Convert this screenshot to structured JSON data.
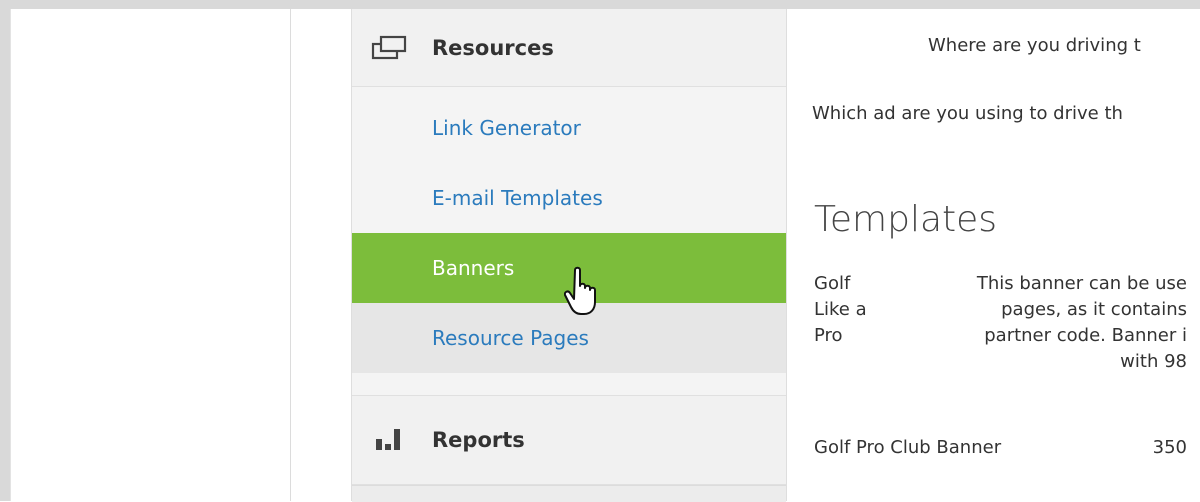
{
  "sidebar": {
    "resources": {
      "title": "Resources",
      "icon": "windows-icon",
      "items": [
        {
          "label": "Link Generator",
          "state": "normal"
        },
        {
          "label": "E-mail Templates",
          "state": "normal"
        },
        {
          "label": "Banners",
          "state": "active"
        },
        {
          "label": "Resource Pages",
          "state": "hover"
        }
      ]
    },
    "reports": {
      "title": "Reports",
      "icon": "bar-chart-icon"
    }
  },
  "main": {
    "question1": "Where are you driving t",
    "question2": "Which ad are you using to drive th",
    "templates_heading": "Templates",
    "rows": [
      {
        "name_lines": [
          "Golf",
          "Like a",
          "Pro"
        ],
        "desc_lines": [
          "This banner can be use",
          "pages, as it contains",
          "partner code. Banner i",
          "with 98"
        ]
      },
      {
        "name_lines": [
          "Golf Pro Club Banner"
        ],
        "desc_lines": [
          "350"
        ]
      }
    ]
  },
  "colors": {
    "active": "#7cbd3b",
    "link": "#2b7bbd"
  }
}
